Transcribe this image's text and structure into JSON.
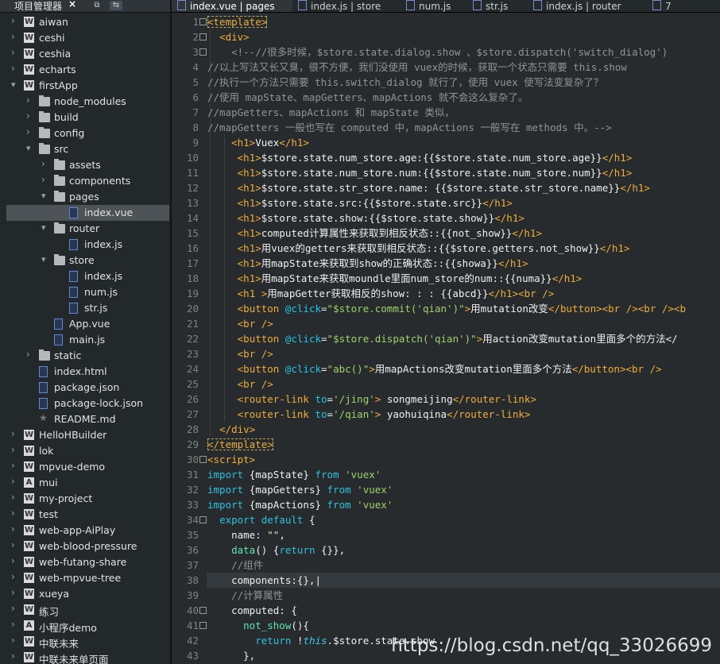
{
  "sidebar": {
    "title": "项目管理器",
    "tree": [
      {
        "label": "aiwan",
        "level": 0,
        "type": "proj",
        "open": false
      },
      {
        "label": "ceshi",
        "level": 0,
        "type": "proj",
        "open": false
      },
      {
        "label": "ceshia",
        "level": 0,
        "type": "proj",
        "open": false
      },
      {
        "label": "echarts",
        "level": 0,
        "type": "proj",
        "open": false
      },
      {
        "label": "firstApp",
        "level": 0,
        "type": "proj",
        "open": true
      },
      {
        "label": "node_modules",
        "level": 1,
        "type": "folder",
        "open": false
      },
      {
        "label": "build",
        "level": 1,
        "type": "folder",
        "open": false
      },
      {
        "label": "config",
        "level": 1,
        "type": "folder",
        "open": false
      },
      {
        "label": "src",
        "level": 1,
        "type": "folder",
        "open": true
      },
      {
        "label": "assets",
        "level": 2,
        "type": "folder",
        "open": false
      },
      {
        "label": "components",
        "level": 2,
        "type": "folder",
        "open": false
      },
      {
        "label": "pages",
        "level": 2,
        "type": "folder",
        "open": true
      },
      {
        "label": "index.vue",
        "level": 3,
        "type": "file",
        "selected": true
      },
      {
        "label": "router",
        "level": 2,
        "type": "folder",
        "open": true
      },
      {
        "label": "index.js",
        "level": 3,
        "type": "file"
      },
      {
        "label": "store",
        "level": 2,
        "type": "folder",
        "open": true
      },
      {
        "label": "index.js",
        "level": 3,
        "type": "file"
      },
      {
        "label": "num.js",
        "level": 3,
        "type": "file"
      },
      {
        "label": "str.js",
        "level": 3,
        "type": "file"
      },
      {
        "label": "App.vue",
        "level": 2,
        "type": "file"
      },
      {
        "label": "main.js",
        "level": 2,
        "type": "file"
      },
      {
        "label": "static",
        "level": 1,
        "type": "folder",
        "open": false
      },
      {
        "label": "index.html",
        "level": 1,
        "type": "file"
      },
      {
        "label": "package.json",
        "level": 1,
        "type": "file"
      },
      {
        "label": "package-lock.json",
        "level": 1,
        "type": "file"
      },
      {
        "label": "README.md",
        "level": 1,
        "type": "star"
      },
      {
        "label": "HelloHBuilder",
        "level": 0,
        "type": "proj",
        "open": false
      },
      {
        "label": "lok",
        "level": 0,
        "type": "proj",
        "open": false
      },
      {
        "label": "mpvue-demo",
        "level": 0,
        "type": "proj",
        "open": false
      },
      {
        "label": "mui",
        "level": 0,
        "type": "proj",
        "open": false,
        "glyph": "A"
      },
      {
        "label": "my-project",
        "level": 0,
        "type": "proj",
        "open": false
      },
      {
        "label": "test",
        "level": 0,
        "type": "proj",
        "open": false
      },
      {
        "label": "web-app-AiPlay",
        "level": 0,
        "type": "proj",
        "open": false
      },
      {
        "label": "web-blood-pressure",
        "level": 0,
        "type": "proj",
        "open": false
      },
      {
        "label": "web-futang-share",
        "level": 0,
        "type": "proj",
        "open": false
      },
      {
        "label": "web-mpvue-tree",
        "level": 0,
        "type": "proj",
        "open": false
      },
      {
        "label": "xueya",
        "level": 0,
        "type": "proj",
        "open": false
      },
      {
        "label": "练习",
        "level": 0,
        "type": "proj",
        "open": false
      },
      {
        "label": "小程序demo",
        "level": 0,
        "type": "proj",
        "open": false,
        "glyph": "A"
      },
      {
        "label": "中联未来",
        "level": 0,
        "type": "proj",
        "open": false
      },
      {
        "label": "中联未来单页面",
        "level": 0,
        "type": "proj",
        "open": false
      }
    ]
  },
  "tabs": [
    {
      "label": "index.vue | pages",
      "active": true
    },
    {
      "label": "index.js | store",
      "active": false
    },
    {
      "label": "num.js",
      "active": false
    },
    {
      "label": "str.js",
      "active": false
    },
    {
      "label": "index.js | router",
      "active": false
    },
    {
      "label": "7",
      "active": false
    }
  ],
  "code": [
    {
      "n": 1,
      "fold": true,
      "segs": [
        [
          "tg",
          "<template>"
        ]
      ],
      "boxed": true
    },
    {
      "n": 2,
      "fold": true,
      "segs": [
        [
          "tx",
          "  "
        ],
        [
          "tg",
          "<div>"
        ]
      ]
    },
    {
      "n": 3,
      "fold": true,
      "segs": [
        [
          "cm",
          "    <!--//很多时候，$store.state.dialog.show 、$store.dispatch('switch_dialog')"
        ]
      ]
    },
    {
      "n": 4,
      "segs": [
        [
          "cm",
          "//以上写法又长又臭，很不方便，我们没使用 vuex的时候，获取一个状态只需要 this.show"
        ]
      ]
    },
    {
      "n": 5,
      "segs": [
        [
          "cm",
          "//执行一个方法只需要 this.switch_dialog 就行了，使用 vuex 使写法变复杂了？"
        ]
      ]
    },
    {
      "n": 6,
      "segs": [
        [
          "cm",
          "//使用 mapState、mapGetters、mapActions 就不会这么复杂了。"
        ]
      ]
    },
    {
      "n": 7,
      "segs": [
        [
          "cm",
          "//mapGetters、mapActions 和 mapState 类似，"
        ]
      ]
    },
    {
      "n": 8,
      "segs": [
        [
          "cm",
          "//mapGetters 一般也写在 computed 中，mapActions 一般写在 methods 中。-->"
        ]
      ]
    },
    {
      "n": 9,
      "segs": [
        [
          "tx",
          "    "
        ],
        [
          "tg",
          "<h1>"
        ],
        [
          "tx",
          "Vuex"
        ],
        [
          "tg",
          "</h1>"
        ]
      ]
    },
    {
      "n": 10,
      "segs": [
        [
          "tx",
          "     "
        ],
        [
          "tg",
          "<h1>"
        ],
        [
          "tx",
          "$store.state.num_store.age:{{$store.state.num_store.age}}"
        ],
        [
          "tg",
          "</h1>"
        ]
      ]
    },
    {
      "n": 11,
      "segs": [
        [
          "tx",
          "     "
        ],
        [
          "tg",
          "<h1>"
        ],
        [
          "tx",
          "$store.state.num_store.num:{{$store.state.num_store.num}}"
        ],
        [
          "tg",
          "</h1>"
        ]
      ]
    },
    {
      "n": 12,
      "segs": [
        [
          "tx",
          "     "
        ],
        [
          "tg",
          "<h1>"
        ],
        [
          "tx",
          "$store.state.str_store.name: {{$store.state.str_store.name}}"
        ],
        [
          "tg",
          "</h1>"
        ]
      ]
    },
    {
      "n": 13,
      "segs": [
        [
          "tx",
          "     "
        ],
        [
          "tg",
          "<h1>"
        ],
        [
          "tx",
          "$store.state.src:{{$store.state.src}}"
        ],
        [
          "tg",
          "</h1>"
        ]
      ]
    },
    {
      "n": 14,
      "segs": [
        [
          "tx",
          "     "
        ],
        [
          "tg",
          "<h1>"
        ],
        [
          "tx",
          "$store.state.show:{{$store.state.show}}"
        ],
        [
          "tg",
          "</h1>"
        ]
      ]
    },
    {
      "n": 15,
      "segs": [
        [
          "tx",
          "     "
        ],
        [
          "tg",
          "<h1>"
        ],
        [
          "tx",
          "computed计算属性来获取到相反状态::{{not_show}}"
        ],
        [
          "tg",
          "</h1>"
        ]
      ]
    },
    {
      "n": 16,
      "segs": [
        [
          "tx",
          "     "
        ],
        [
          "tg",
          "<h1>"
        ],
        [
          "tx",
          "用vuex的getters来获取到相反状态::{{$store.getters.not_show}}"
        ],
        [
          "tg",
          "</h1>"
        ]
      ]
    },
    {
      "n": 17,
      "segs": [
        [
          "tx",
          "     "
        ],
        [
          "tg",
          "<h1>"
        ],
        [
          "tx",
          "用mapState来获取到show的正确状态::{{showa}}"
        ],
        [
          "tg",
          "</h1>"
        ]
      ]
    },
    {
      "n": 18,
      "segs": [
        [
          "tx",
          "     "
        ],
        [
          "tg",
          "<h1>"
        ],
        [
          "tx",
          "用mapState来获取moundle里面num_store的num::{{numa}}"
        ],
        [
          "tg",
          "</h1>"
        ]
      ]
    },
    {
      "n": 19,
      "segs": [
        [
          "tx",
          "     "
        ],
        [
          "tg",
          "<h1 >"
        ],
        [
          "tx",
          "用mapGetter获取相反的show: : : {{abcd}}"
        ],
        [
          "tg",
          "</h1><br />"
        ]
      ]
    },
    {
      "n": 20,
      "segs": [
        [
          "tx",
          "     "
        ],
        [
          "tg",
          "<button "
        ],
        [
          "at",
          "@click"
        ],
        [
          "tx",
          "="
        ],
        [
          "st",
          "\"$store.commit('qian')\""
        ],
        [
          "tg",
          ">"
        ],
        [
          "tx",
          "用mutation改变"
        ],
        [
          "tg",
          "</button><br /><br /><b"
        ]
      ]
    },
    {
      "n": 21,
      "segs": [
        [
          "tx",
          "     "
        ],
        [
          "tg",
          "<br />"
        ]
      ]
    },
    {
      "n": 22,
      "segs": [
        [
          "tx",
          "     "
        ],
        [
          "tg",
          "<button "
        ],
        [
          "at",
          "@click"
        ],
        [
          "tx",
          "="
        ],
        [
          "st",
          "\"$store.dispatch('qian')\""
        ],
        [
          "tg",
          ">"
        ],
        [
          "tx",
          "用action改变mutation里面多个的方法</"
        ]
      ]
    },
    {
      "n": 23,
      "segs": [
        [
          "tx",
          "     "
        ],
        [
          "tg",
          "<br />"
        ]
      ]
    },
    {
      "n": 24,
      "segs": [
        [
          "tx",
          "     "
        ],
        [
          "tg",
          "<button "
        ],
        [
          "at",
          "@click"
        ],
        [
          "tx",
          "="
        ],
        [
          "st",
          "\"abc()\""
        ],
        [
          "tg",
          ">"
        ],
        [
          "tx",
          "用mapActions改变mutation里面多个方法"
        ],
        [
          "tg",
          "</button><br />"
        ]
      ]
    },
    {
      "n": 25,
      "segs": [
        [
          "tx",
          "     "
        ],
        [
          "tg",
          "<br />"
        ]
      ]
    },
    {
      "n": 26,
      "segs": [
        [
          "tx",
          "     "
        ],
        [
          "tg",
          "<router-link "
        ],
        [
          "at",
          "to"
        ],
        [
          "tx",
          "="
        ],
        [
          "st",
          "'/jing'"
        ],
        [
          "tg",
          ">"
        ],
        [
          "tx",
          " songmeijing"
        ],
        [
          "tg",
          "</router-link>"
        ]
      ]
    },
    {
      "n": 27,
      "segs": [
        [
          "tx",
          "     "
        ],
        [
          "tg",
          "<router-link "
        ],
        [
          "at",
          "to"
        ],
        [
          "tx",
          "="
        ],
        [
          "st",
          "'/qian'"
        ],
        [
          "tg",
          ">"
        ],
        [
          "tx",
          " yaohuiqina"
        ],
        [
          "tg",
          "</router-link>"
        ]
      ]
    },
    {
      "n": 28,
      "segs": [
        [
          "tx",
          "  "
        ],
        [
          "tg",
          "</div>"
        ]
      ]
    },
    {
      "n": 29,
      "segs": [
        [
          "tg",
          "</template>"
        ]
      ],
      "boxed": true
    },
    {
      "n": 30,
      "fold": true,
      "segs": [
        [
          "tg",
          "<script>"
        ]
      ]
    },
    {
      "n": 31,
      "segs": [
        [
          "kw",
          "import "
        ],
        [
          "tx",
          "{mapState} "
        ],
        [
          "kw",
          "from "
        ],
        [
          "st",
          "'vuex'"
        ]
      ]
    },
    {
      "n": 32,
      "segs": [
        [
          "kw",
          "import "
        ],
        [
          "tx",
          "{mapGetters} "
        ],
        [
          "kw",
          "from "
        ],
        [
          "st",
          "'vuex'"
        ]
      ]
    },
    {
      "n": 33,
      "segs": [
        [
          "kw",
          "import "
        ],
        [
          "tx",
          "{mapActions} "
        ],
        [
          "kw",
          "from "
        ],
        [
          "st",
          "'vuex'"
        ]
      ]
    },
    {
      "n": 34,
      "fold": true,
      "segs": [
        [
          "tx",
          "  "
        ],
        [
          "kw",
          "export default "
        ],
        [
          "tx",
          "{"
        ]
      ]
    },
    {
      "n": 35,
      "segs": [
        [
          "tx",
          "    name: "
        ],
        [
          "ex",
          "\"\""
        ],
        [
          "tx",
          ","
        ]
      ]
    },
    {
      "n": 36,
      "segs": [
        [
          "tx",
          "    "
        ],
        [
          "fn",
          "data"
        ],
        [
          "tx",
          "() {"
        ],
        [
          "kw",
          "return "
        ],
        [
          "tx",
          "{}},"
        ]
      ]
    },
    {
      "n": 37,
      "segs": [
        [
          "cm",
          "    //组件"
        ]
      ]
    },
    {
      "n": 38,
      "current": true,
      "segs": [
        [
          "tx",
          "    components:{},|"
        ]
      ]
    },
    {
      "n": 39,
      "segs": [
        [
          "cm",
          "    //计算属性"
        ]
      ]
    },
    {
      "n": 40,
      "fold": true,
      "segs": [
        [
          "tx",
          "    computed: {"
        ]
      ]
    },
    {
      "n": 41,
      "fold": true,
      "segs": [
        [
          "tx",
          "      "
        ],
        [
          "fn",
          "not_show"
        ],
        [
          "tx",
          "(){"
        ]
      ]
    },
    {
      "n": 42,
      "segs": [
        [
          "tx",
          "        "
        ],
        [
          "kw",
          "return "
        ],
        [
          "tx",
          "!"
        ],
        [
          "it",
          "this"
        ],
        [
          "tx",
          ".$store.state.show"
        ]
      ]
    },
    {
      "n": 43,
      "segs": [
        [
          "tx",
          "      },"
        ]
      ]
    }
  ],
  "watermark": "https://blog.csdn.net/qq_33026699"
}
